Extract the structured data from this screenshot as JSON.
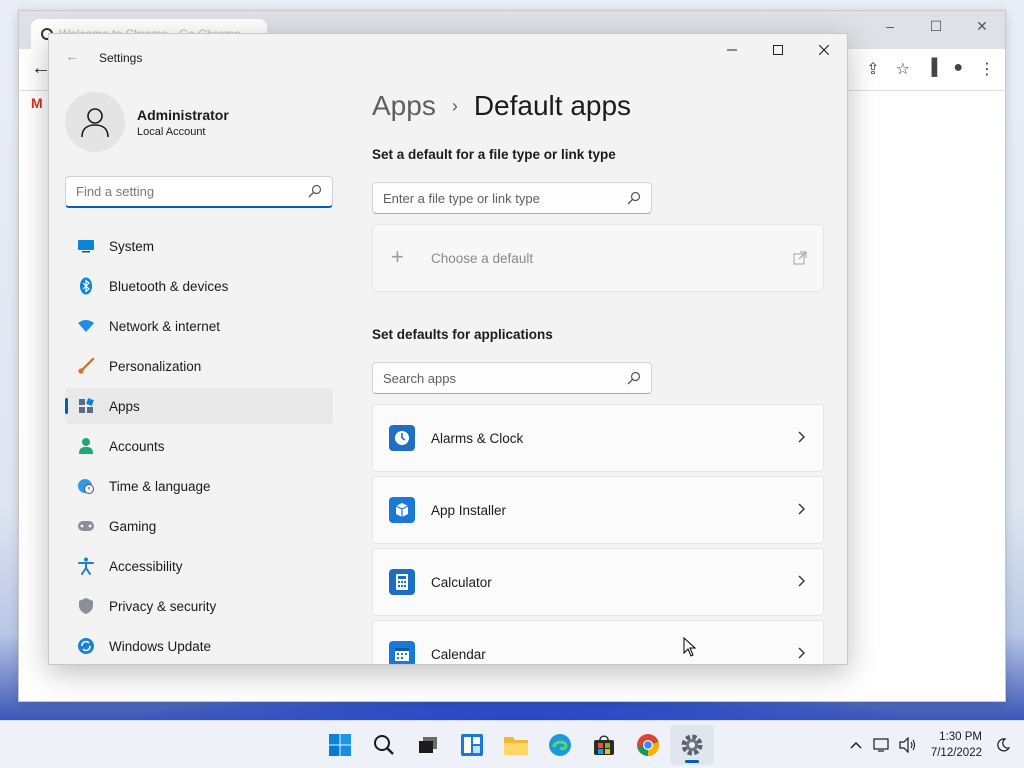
{
  "browser": {
    "tab_title": "Welcome to Chrome - Go Chrome",
    "ctrl_min": "–",
    "ctrl_max": "☐",
    "ctrl_close": "✕",
    "gmail_letter": "M"
  },
  "settings": {
    "window_title": "Settings",
    "profile": {
      "name": "Administrator",
      "account_type": "Local Account"
    },
    "find_placeholder": "Find a setting",
    "nav": [
      {
        "label": "System",
        "icon": "monitor-icon"
      },
      {
        "label": "Bluetooth & devices",
        "icon": "bluetooth-icon"
      },
      {
        "label": "Network & internet",
        "icon": "wifi-icon"
      },
      {
        "label": "Personalization",
        "icon": "brush-icon"
      },
      {
        "label": "Apps",
        "icon": "apps-icon",
        "active": true
      },
      {
        "label": "Accounts",
        "icon": "person-icon"
      },
      {
        "label": "Time & language",
        "icon": "globe-clock-icon"
      },
      {
        "label": "Gaming",
        "icon": "gamepad-icon"
      },
      {
        "label": "Accessibility",
        "icon": "accessibility-icon"
      },
      {
        "label": "Privacy & security",
        "icon": "shield-icon"
      },
      {
        "label": "Windows Update",
        "icon": "update-icon"
      }
    ],
    "breadcrumb": {
      "parent": "Apps",
      "current": "Default apps"
    },
    "file_type_heading": "Set a default for a file type or link type",
    "file_type_placeholder": "Enter a file type or link type",
    "choose_default_label": "Choose a default",
    "app_defaults_heading": "Set defaults for applications",
    "search_apps_placeholder": "Search apps",
    "apps": [
      {
        "name": "Alarms & Clock",
        "icon": "alarm-clock-icon"
      },
      {
        "name": "App Installer",
        "icon": "package-icon"
      },
      {
        "name": "Calculator",
        "icon": "calculator-icon"
      },
      {
        "name": "Calendar",
        "icon": "calendar-icon"
      }
    ]
  },
  "taskbar": {
    "apps": [
      "start-icon",
      "search-icon",
      "task-view-icon",
      "widgets-icon",
      "file-explorer-icon",
      "edge-icon",
      "store-icon",
      "chrome-icon",
      "settings-icon"
    ],
    "running": "settings-icon",
    "time": "1:30 PM",
    "date": "7/12/2022"
  },
  "colors": {
    "accent": "#005fb8",
    "window_bg": "#f3f3f3",
    "card_bg": "#fbfbfb",
    "taskbar_bg": "#eef1f7"
  }
}
